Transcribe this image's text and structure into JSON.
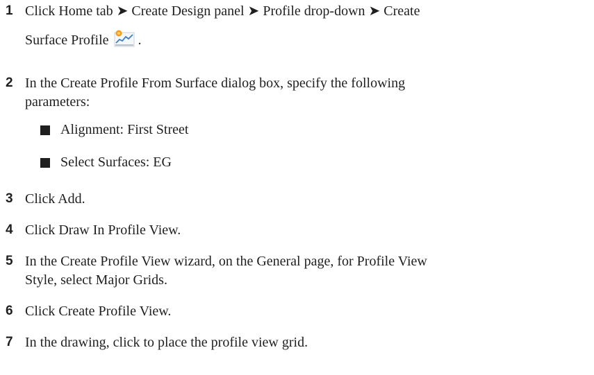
{
  "steps": [
    {
      "num": "1",
      "line1": "Click Home tab ➤ Create Design panel ➤ Profile drop-down ➤ Create",
      "line2": "Surface Profile",
      "line2_suffix": ".",
      "icon": "create-surface-profile-icon"
    },
    {
      "num": "2",
      "line1": "In the Create Profile From Surface dialog box, specify the following",
      "line2": "parameters:",
      "bullets": [
        "Alignment: First Street",
        "Select Surfaces: EG"
      ]
    },
    {
      "num": "3",
      "text": "Click Add."
    },
    {
      "num": "4",
      "text": "Click Draw In Profile View."
    },
    {
      "num": "5",
      "line1": "In the Create Profile View wizard, on the General page, for Profile View",
      "line2": "Style, select Major Grids."
    },
    {
      "num": "6",
      "text": "Click Create Profile View."
    },
    {
      "num": "7",
      "text": "In the drawing, click to place the profile view grid."
    }
  ],
  "colors": {
    "text": "#1f1f1f",
    "icon_accent": "#f39c1f",
    "icon_line": "#3d7fc4"
  }
}
